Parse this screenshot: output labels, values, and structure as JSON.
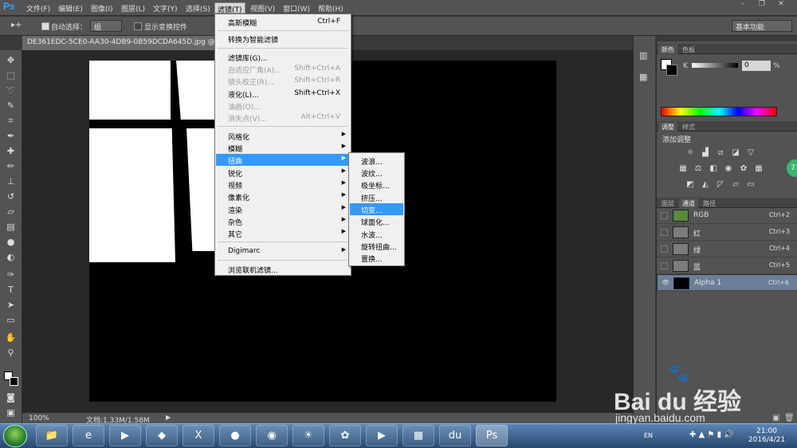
{
  "app": {
    "logo": "Ps"
  },
  "menubar": {
    "items": [
      "文件(F)",
      "编辑(E)",
      "图像(I)",
      "图层(L)",
      "文字(Y)",
      "选择(S)",
      "滤镜(T)",
      "视图(V)",
      "窗口(W)",
      "帮助(H)"
    ],
    "active_index": 6,
    "window_controls": [
      "–",
      "❐",
      "✕"
    ]
  },
  "options": {
    "auto_select_label": "自动选择：",
    "auto_select_value": "组",
    "show_transform_label": "显示变换控件",
    "workspace": "基本功能"
  },
  "document": {
    "tab_title": "DE361EDC-5CE0-AA30-4DB9-0B59DCDA645D.jpg @ 100%",
    "zoom": "100%",
    "doc_size": "文档:1.33M/1.58M"
  },
  "filter_menu": {
    "items": [
      {
        "label": "高斯模糊",
        "shortcut": "Ctrl+F"
      },
      {
        "label": "转换为智能滤镜"
      },
      {
        "label": "滤镜库(G)..."
      },
      {
        "label": "自适应广角(A)...",
        "shortcut": "Shift+Ctrl+A",
        "disabled": true
      },
      {
        "label": "镜头校正(R)...",
        "shortcut": "Shift+Ctrl+R",
        "disabled": true
      },
      {
        "label": "液化(L)...",
        "shortcut": "Shift+Ctrl+X"
      },
      {
        "label": "油画(O)...",
        "disabled": true
      },
      {
        "label": "消失点(V)...",
        "shortcut": "Alt+Ctrl+V",
        "disabled": true
      },
      {
        "label": "风格化",
        "submenu": true
      },
      {
        "label": "模糊",
        "submenu": true
      },
      {
        "label": "扭曲",
        "submenu": true,
        "highlighted": true
      },
      {
        "label": "锐化",
        "submenu": true
      },
      {
        "label": "视频",
        "submenu": true
      },
      {
        "label": "像素化",
        "submenu": true
      },
      {
        "label": "渲染",
        "submenu": true
      },
      {
        "label": "杂色",
        "submenu": true
      },
      {
        "label": "其它",
        "submenu": true
      },
      {
        "label": "Digimarc",
        "submenu": true
      },
      {
        "label": "浏览联机滤镜..."
      }
    ]
  },
  "distort_submenu": {
    "items": [
      "波浪...",
      "波纹...",
      "极坐标...",
      "挤压...",
      "切变...",
      "球面化...",
      "水波...",
      "旋转扭曲...",
      "置换..."
    ],
    "highlighted_index": 4
  },
  "panels": {
    "color_tabs": [
      "颜色",
      "色板"
    ],
    "color_k_label": "K",
    "color_k_value": "0",
    "color_k_unit": "%",
    "adjust_tabs": [
      "调整",
      "样式"
    ],
    "adjust_title": "添加调整",
    "layer_tabs": [
      "图层",
      "通道",
      "路径"
    ],
    "channels": [
      {
        "name": "RGB",
        "shortcut": "Ctrl+2"
      },
      {
        "name": "红",
        "shortcut": "Ctrl+3"
      },
      {
        "name": "绿",
        "shortcut": "Ctrl+4"
      },
      {
        "name": "蓝",
        "shortcut": "Ctrl+5"
      },
      {
        "name": "Alpha 1",
        "shortcut": "Ctrl+6",
        "selected": true
      }
    ],
    "badge": "73"
  },
  "taskbar": {
    "time": "21:00",
    "date": "2016/4/21",
    "lang": "EN"
  },
  "watermark": {
    "brand": "Bai du 经验",
    "url": "jingyan.baidu.com"
  }
}
